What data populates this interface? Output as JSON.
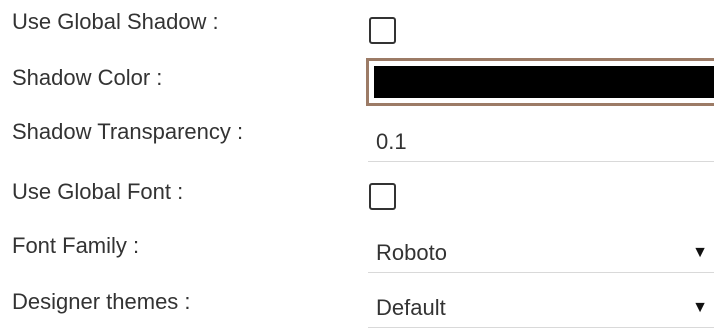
{
  "settings": {
    "use_global_shadow": {
      "label": "Use Global Shadow :",
      "checked": false
    },
    "shadow_color": {
      "label": "Shadow Color :",
      "value": "#000000"
    },
    "shadow_transparency": {
      "label": "Shadow Transparency :",
      "value": "0.1"
    },
    "use_global_font": {
      "label": "Use Global Font :",
      "checked": false
    },
    "font_family": {
      "label": "Font Family :",
      "selected": "Roboto",
      "arrow_icon": "caret-down-icon"
    },
    "designer_themes": {
      "label": "Designer themes :",
      "selected": "Default",
      "arrow_icon": "caret-down-icon"
    }
  },
  "colors": {
    "swatch_border": "#9c7b66",
    "text": "#333333",
    "divider": "#d9d9d9"
  }
}
